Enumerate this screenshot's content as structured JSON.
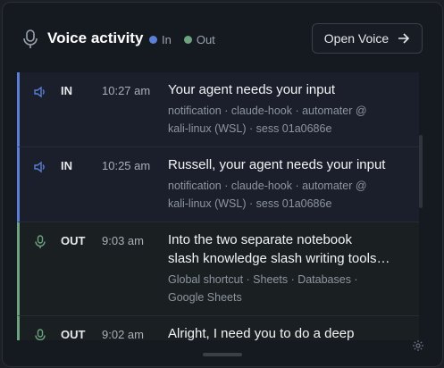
{
  "header": {
    "title": "Voice activity",
    "mic_icon": "mic-icon",
    "legend": [
      {
        "label": "In",
        "color": "#5b7fd6"
      },
      {
        "label": "Out",
        "color": "#6ea37f"
      }
    ],
    "open_button": {
      "label": "Open Voice",
      "icon": "arrow-right-icon"
    }
  },
  "entries": [
    {
      "direction": "IN",
      "icon": "speaker-icon",
      "time": "10:27 am",
      "message": "Your agent needs your input",
      "meta_line1": "notification · claude-hook · automater @",
      "meta_line2": "kali-linux (WSL) · sess 01a0686e"
    },
    {
      "direction": "IN",
      "icon": "speaker-icon",
      "time": "10:25 am",
      "message": "Russell, your agent needs your input",
      "meta_line1": "notification · claude-hook · automater @",
      "meta_line2": "kali-linux (WSL) · sess 01a0686e"
    },
    {
      "direction": "OUT",
      "icon": "mic-icon",
      "time": "9:03 am",
      "message_line1": "Into the two separate notebook",
      "message_line2": "slash knowledge slash writing tools…",
      "meta_line1": "Global shortcut · Sheets · Databases ·",
      "meta_line2": "Google Sheets"
    },
    {
      "direction": "OUT",
      "icon": "mic-icon",
      "time": "9:02 am",
      "message": "Alright, I need you to do a deep"
    }
  ],
  "colors": {
    "in_accent": "#5b7fd6",
    "out_accent": "#6ea37f",
    "background": "#151920"
  },
  "footer": {
    "settings_icon": "gear-icon"
  }
}
